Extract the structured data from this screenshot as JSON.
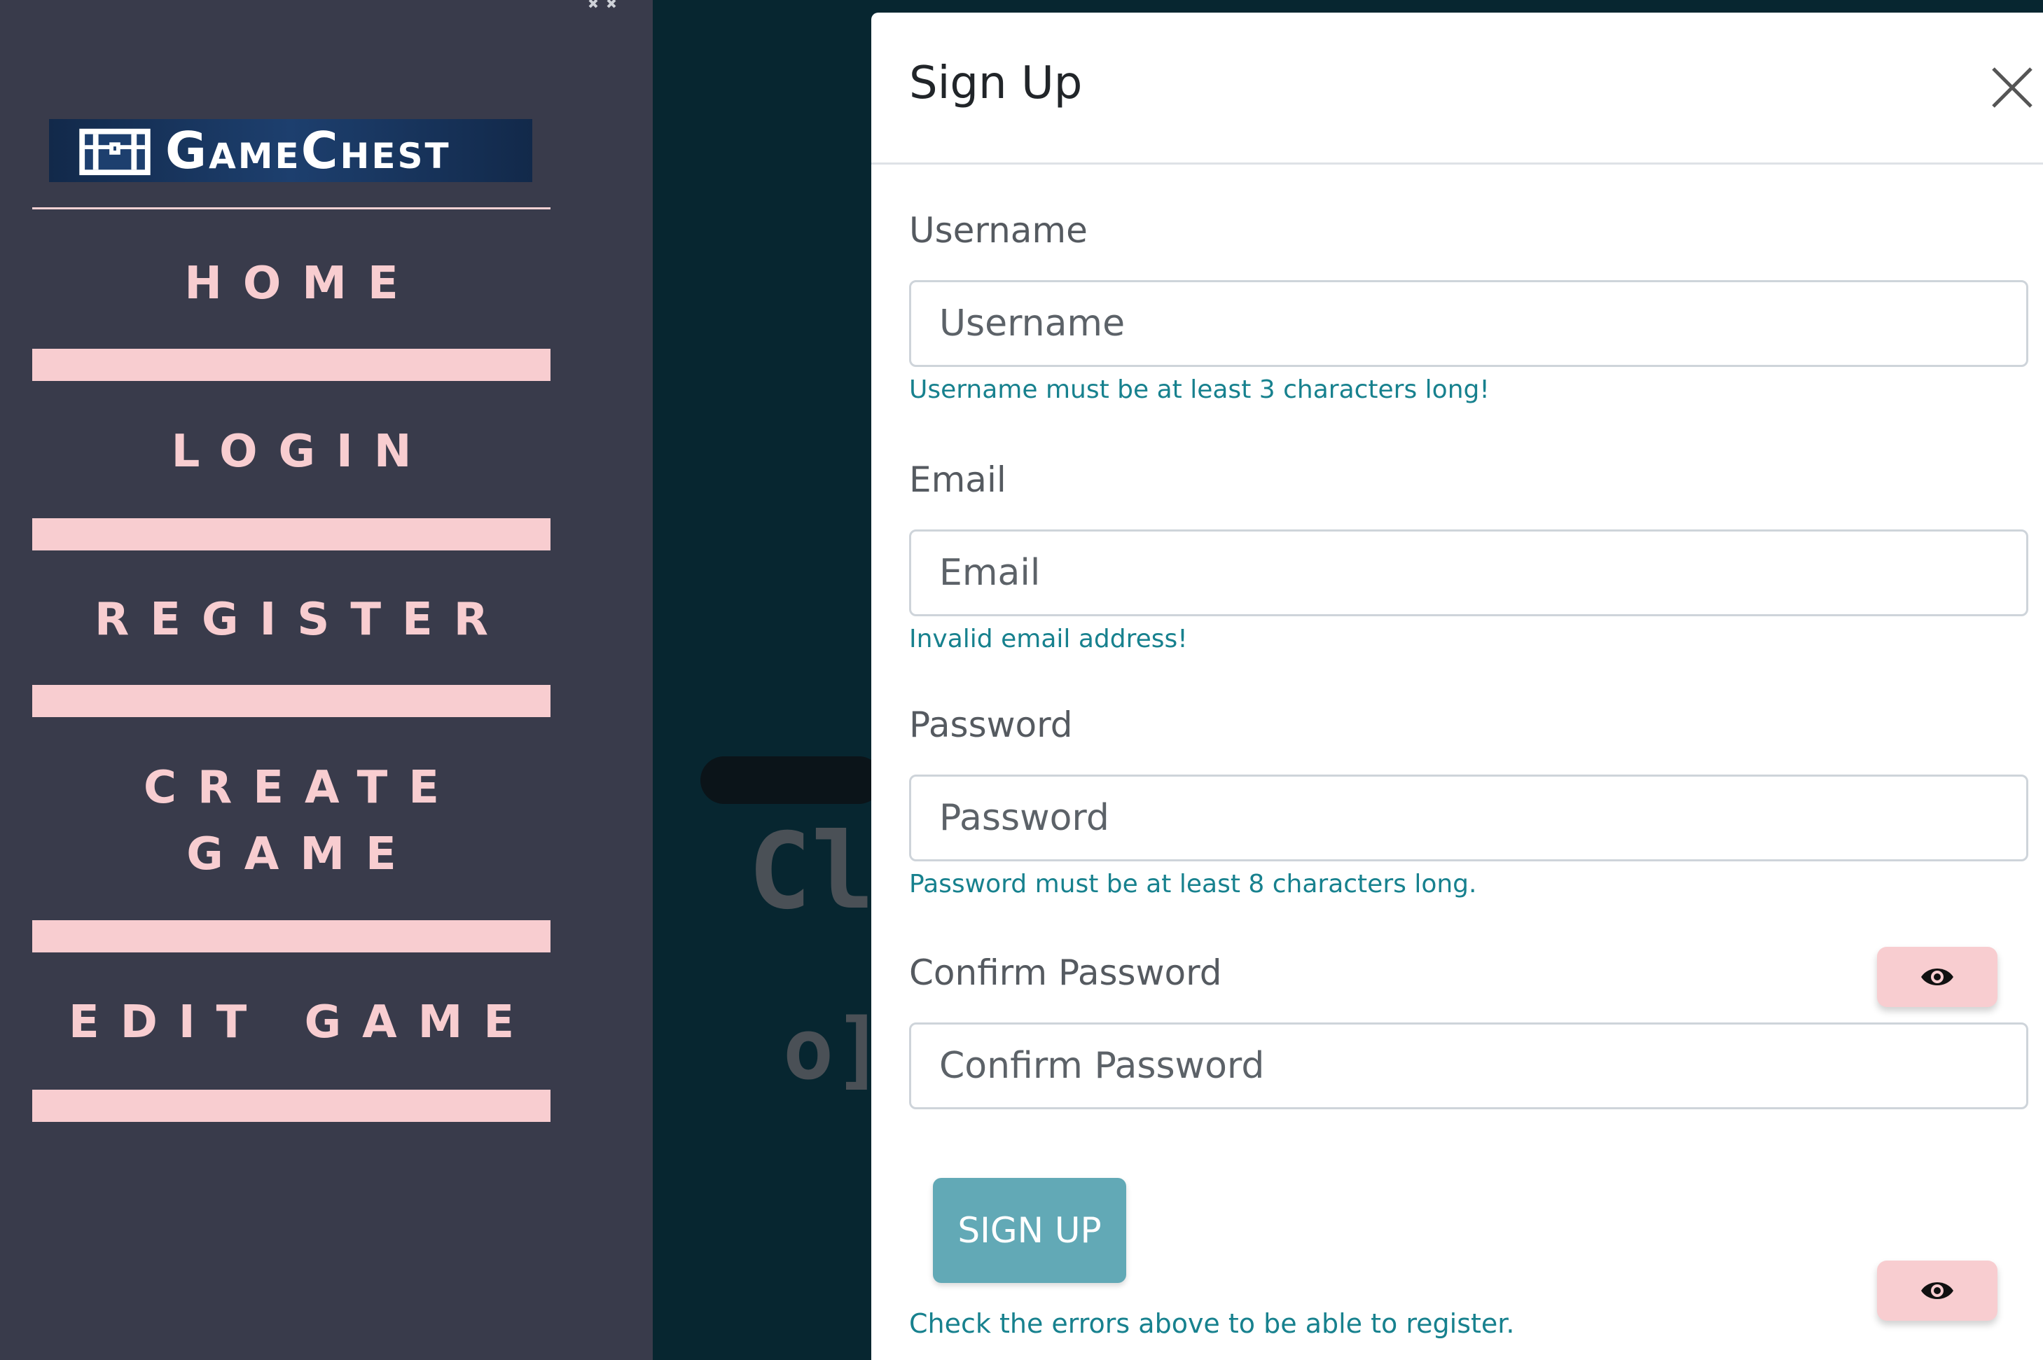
{
  "sidebar": {
    "logo_text": "GameChest",
    "nav": [
      {
        "label": "HOME"
      },
      {
        "label": "LOGIN"
      },
      {
        "label": "REGISTER"
      },
      {
        "label": "CREATE"
      },
      {
        "label": "GAME"
      },
      {
        "label": "EDIT GAME"
      }
    ]
  },
  "background": {
    "text_1": "Cl",
    "text_2": "o]"
  },
  "modal": {
    "title": "Sign Up",
    "fields": {
      "username": {
        "label": "Username",
        "placeholder": "Username",
        "error": "Username must be at least 3 characters long!"
      },
      "email": {
        "label": "Email",
        "placeholder": "Email",
        "error": "Invalid email address!"
      },
      "password": {
        "label": "Password",
        "placeholder": "Password",
        "error": "Password must be at least 8 characters long."
      },
      "confirm": {
        "label": "Confirm Password",
        "placeholder": "Confirm Password"
      }
    },
    "submit_label": "SIGN UP",
    "form_error": "Check the errors above to be able to register."
  },
  "icons": {
    "close": "close-icon",
    "eye": "eye-icon",
    "sidebar_close": "close-icon"
  },
  "colors": {
    "sidebar_bg": "#393b4b",
    "nav_pink": "#f8cdd0",
    "page_bg": "#072630",
    "error_teal": "#17818e",
    "button_teal": "#62a9b6"
  }
}
